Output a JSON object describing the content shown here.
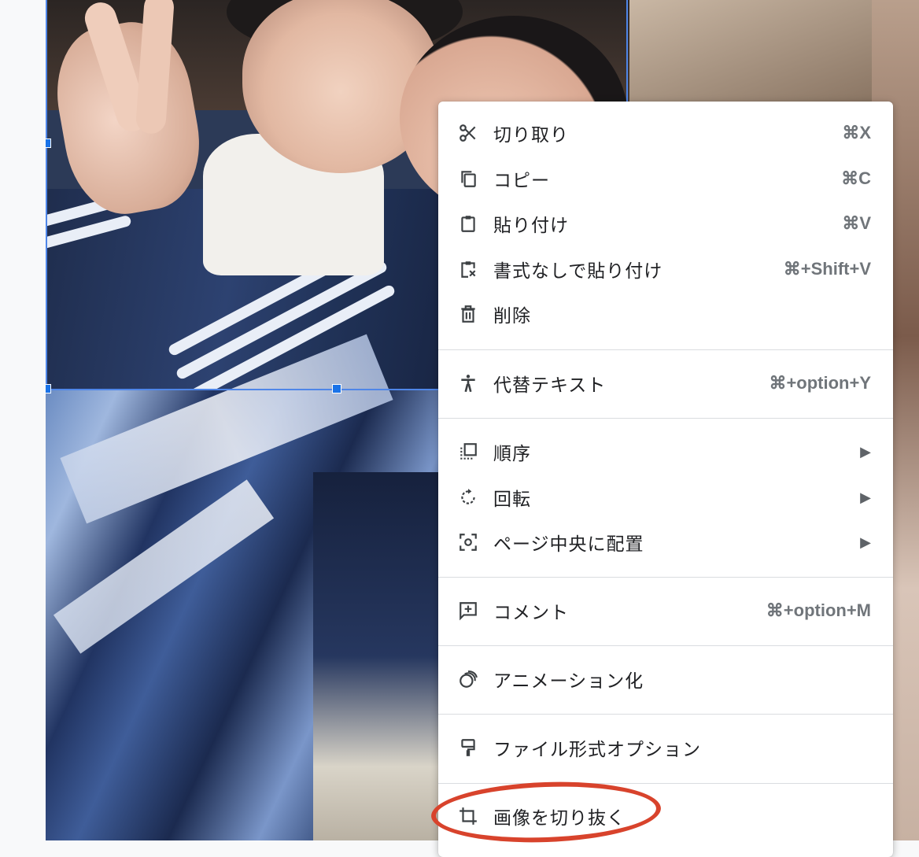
{
  "menu": {
    "items": [
      {
        "label": "切り取り",
        "shortcut": "⌘X",
        "icon": "scissors-icon"
      },
      {
        "label": "コピー",
        "shortcut": "⌘C",
        "icon": "copy-icon"
      },
      {
        "label": "貼り付け",
        "shortcut": "⌘V",
        "icon": "clipboard-icon"
      },
      {
        "label": "書式なしで貼り付け",
        "shortcut": "⌘+Shift+V",
        "icon": "paste-plain-icon"
      },
      {
        "label": "削除",
        "shortcut": "",
        "icon": "trash-icon"
      },
      {
        "label": "代替テキスト",
        "shortcut": "⌘+option+Y",
        "icon": "accessibility-icon"
      },
      {
        "label": "順序",
        "submenu": true,
        "icon": "order-icon"
      },
      {
        "label": "回転",
        "submenu": true,
        "icon": "rotate-icon"
      },
      {
        "label": "ページ中央に配置",
        "submenu": true,
        "icon": "center-icon"
      },
      {
        "label": "コメント",
        "shortcut": "⌘+option+M",
        "icon": "add-comment-icon"
      },
      {
        "label": "アニメーション化",
        "shortcut": "",
        "icon": "animation-icon"
      },
      {
        "label": "ファイル形式オプション",
        "shortcut": "",
        "icon": "format-paint-icon"
      },
      {
        "label": "画像を切り抜く",
        "shortcut": "",
        "icon": "crop-icon"
      }
    ],
    "submenu_arrow": "▶"
  },
  "colors": {
    "selection": "#4f86e8",
    "highlight": "#d8432c"
  }
}
